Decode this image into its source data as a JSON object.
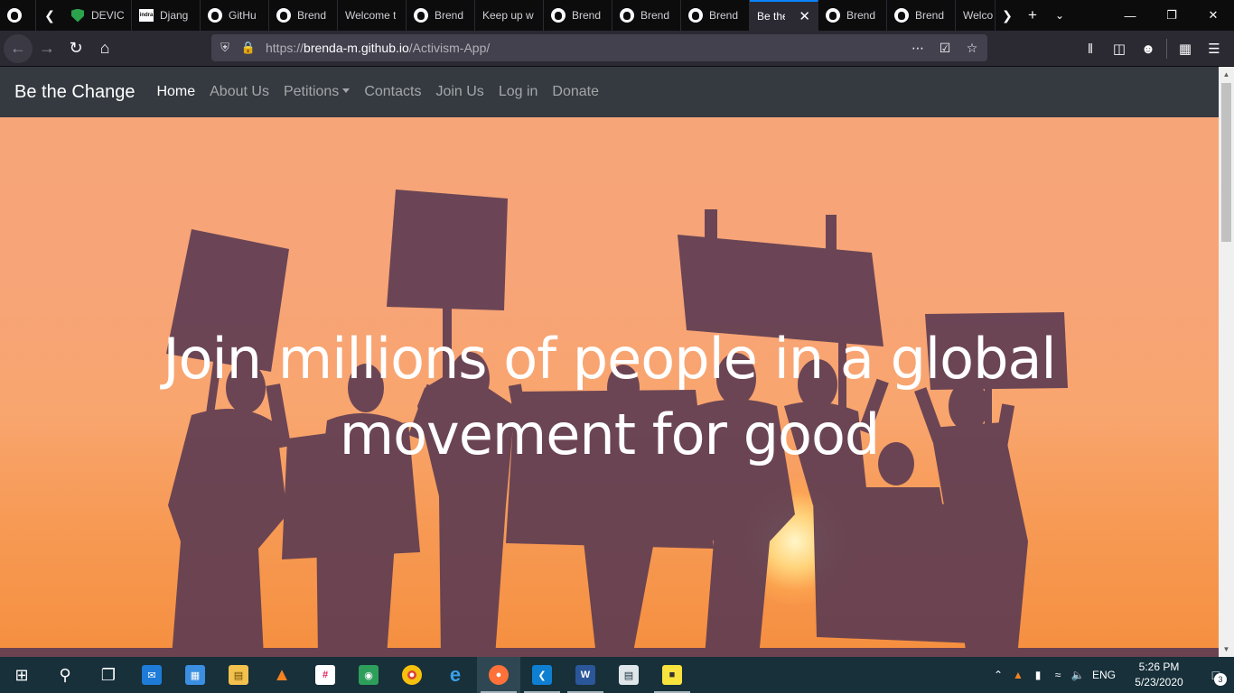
{
  "browser": {
    "tabs": [
      {
        "title": "",
        "icon": "github-icon"
      },
      {
        "title": "DEVIC",
        "icon": "shield-icon"
      },
      {
        "title": "Djang",
        "icon": "django-icon"
      },
      {
        "title": "GitHu",
        "icon": "github-icon"
      },
      {
        "title": "Brend",
        "icon": "github-icon"
      },
      {
        "title": "Welcome t",
        "icon": ""
      },
      {
        "title": "Brend",
        "icon": "github-icon"
      },
      {
        "title": "Keep up w",
        "icon": ""
      },
      {
        "title": "Brend",
        "icon": "github-icon"
      },
      {
        "title": "Brend",
        "icon": "github-icon"
      },
      {
        "title": "Brend",
        "icon": "github-icon"
      },
      {
        "title": "Be the",
        "icon": "",
        "active": true
      },
      {
        "title": "Brend",
        "icon": "github-icon"
      },
      {
        "title": "Brend",
        "icon": "github-icon"
      },
      {
        "title": "Welco",
        "icon": ""
      }
    ],
    "url": {
      "scheme": "https://",
      "domain": "brenda-m.github.io",
      "path": "/Activism-App/"
    },
    "accent": "#0a84ff"
  },
  "site": {
    "brand": "Be the Change",
    "nav": {
      "home": "Home",
      "about": "About Us",
      "petitions": "Petitions",
      "contacts": "Contacts",
      "join": "Join Us",
      "login": "Log in",
      "donate": "Donate"
    },
    "hero": {
      "line1": "Join millions of people in a global",
      "line2": "movement for good"
    },
    "colors": {
      "navbar": "#343a40",
      "hero_sky": "#f7a36a",
      "silhouette": "#5b3a4f"
    }
  },
  "taskbar": {
    "apps": [
      "windows-start-icon",
      "search-icon",
      "task-view-icon",
      "mail-icon",
      "store-icon",
      "file-explorer-icon",
      "vlc-icon",
      "slack-icon",
      "maps-icon",
      "chrome-icon",
      "edge-icon",
      "firefox-icon",
      "vscode-icon",
      "word-icon",
      "photos-icon",
      "sticky-notes-icon"
    ],
    "language": "ENG",
    "time": "5:26 PM",
    "date": "5/23/2020",
    "notifications": "3"
  }
}
